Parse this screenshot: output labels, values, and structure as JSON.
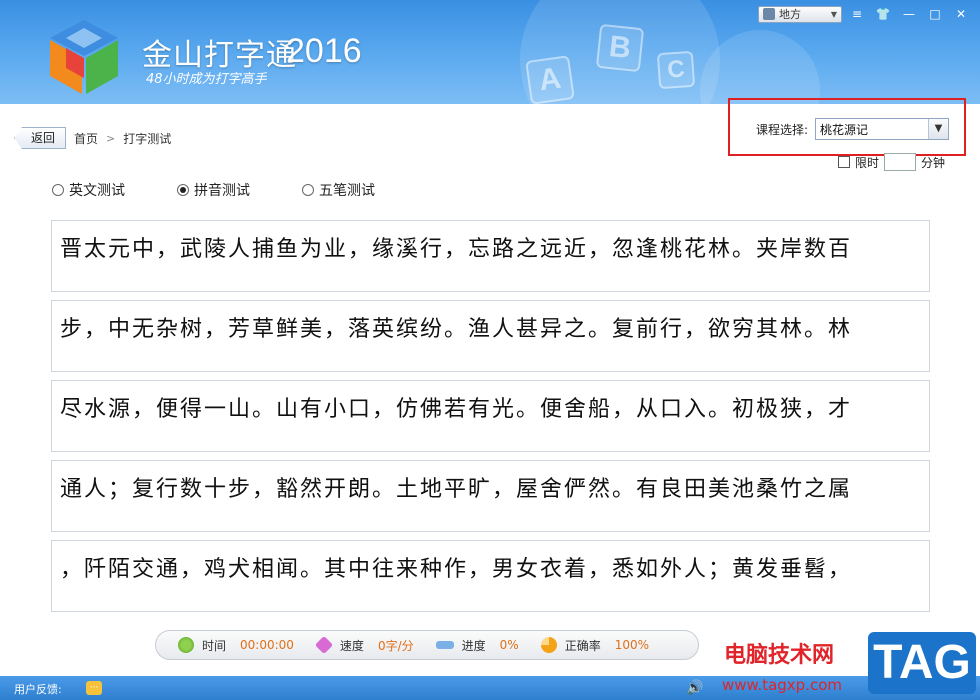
{
  "app": {
    "name": "金山打字通",
    "year": "2016",
    "slogan": "48小时成为打字高手",
    "decor_letters": [
      "A",
      "B",
      "C"
    ]
  },
  "window": {
    "user_label": "地方",
    "skin_icon": "shirt-icon",
    "menu_icon": "menu-icon"
  },
  "nav": {
    "back": "返回",
    "crumbs": [
      "首页",
      "打字测试"
    ],
    "separator": ">"
  },
  "course": {
    "label": "课程选择:",
    "selected": "桃花源记",
    "time_limit_label": "限时",
    "minutes_label": "分钟",
    "minutes_value": ""
  },
  "modes": [
    {
      "label": "英文测试",
      "selected": false
    },
    {
      "label": "拼音测试",
      "selected": true
    },
    {
      "label": "五笔测试",
      "selected": false
    }
  ],
  "lines": [
    "晋太元中，武陵人捕鱼为业，缘溪行，忘路之远近，忽逢桃花林。夹岸数百",
    "步，中无杂树，芳草鲜美，落英缤纷。渔人甚异之。复前行，欲穷其林。林",
    "尽水源，便得一山。山有小口，仿佛若有光。便舍船，从口入。初极狭，才",
    "通人；复行数十步，豁然开朗。土地平旷，屋舍俨然。有良田美池桑竹之属",
    "，阡陌交通，鸡犬相闻。其中往来种作，男女衣着，悉如外人；黄发垂髫，"
  ],
  "stats": {
    "time_label": "时间",
    "time_value": "00:00:00",
    "speed_label": "速度",
    "speed_value": "0字/分",
    "progress_label": "进度",
    "progress_value": "0%",
    "accuracy_label": "正确率",
    "accuracy_value": "100%"
  },
  "footer": {
    "feedback_label": "用户反馈:"
  },
  "watermark": {
    "site_name": "电脑技术网",
    "url": "www.tagxp.com",
    "tag": "TAG"
  },
  "colors": {
    "header_blue": "#3a8fe2",
    "highlight_red": "#e02020",
    "stat_value_orange": "#e0701a"
  }
}
